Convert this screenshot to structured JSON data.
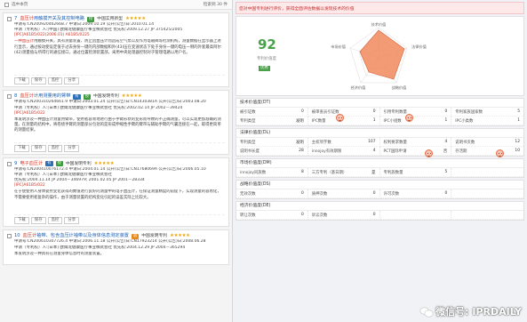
{
  "left": {
    "toolbar": {
      "select_label": "选中本页",
      "page_info": "检索到 30 件"
    },
    "results": [
      {
        "num": "7",
        "title_hl": "血压计",
        "title_rest": "用触摸开关及其控制电路",
        "type": "中国实用新型",
        "stars": "★★★★★",
        "meta1": "申请号:CN200920462668.7  申请日:2009.10.19  公开(公告)日:2010.01.14",
        "meta2": "申请（专利权）人:[中国] 欧姆龙健康医疗事业株式会社  优先权:2009.12.27 JP 375425/2005",
        "ipc": "[IPC]A61B5/022(2006.01) A61B5/0225",
        "abstract_hl": "一种血压计",
        "abstract_rest": "用触摸开关，具有测量装置、防止因血压计而造成空气泵以及作为电磁阀等检测机构，测量数据在显示器上进行显示，通过按动使设定值于过去身份一键的内部数据和外(43)压在变速状态下处于身份一键的电压一侧的外套最高阿尔(42)测量值与所得行的通信接口，通过位置检测装置部，采用中央处理器控制对于管理电路以用户名。",
        "actions": [
          "下载",
          "保存",
          "监控",
          "分享"
        ]
      },
      {
        "num": "8",
        "title_hl": "血压计",
        "title_rest": "计用测量用的臂带",
        "type": "中国发明专利",
        "stars": "★★★★★",
        "meta1": "申请号:CN200310264661.9  申请日:2003.01.24  公开(公告)日:CN1430381A  公开(公告)日:2003.08.20",
        "meta2": "申请（专利权）人:[日本] 欧姆龙健康医疗事业株式会社  优先权:2002.02.14 JP 2002－39424",
        "ipc": "[IPC]A61B5/022",
        "abstract_hl": "",
        "abstract_rest": "本发明涉及一种血压计测量用臂带，使用者容易地进行由于手臂形状的变形而导致的不正确测量，可以实现更加准确的测量。在测量的结构中，将卷绕手臂的测量部分包括的是形成伸缩性手臂的臂带与辅助手臂的气囊连接在一起，取得更简单的测量结果。",
        "actions": [
          "下载",
          "保存",
          "监控",
          "分享"
        ]
      },
      {
        "num": "9",
        "title_hl": "电子血压计",
        "title_rest": "",
        "type": "中国发明专利",
        "stars": "★★★★★",
        "meta1": "申请号:CN200410076172.4  申请日:2004.01.14  公开(公告)日:CN1768069A  公开(公告)日:2006.05.10",
        "meta2": "申请（专利权）人:[日本] 欧姆龙健康医疗事业株式会社",
        "meta3": "优先权:2004.11.14 JP 2004－346979; 2001.02.05 JP 2001－28334",
        "ipc": "[IPC]A61B5/022",
        "abstract_hl": "",
        "abstract_rest": "在于使使用人身体姿势变化获得的数值进行良好的测量中的电子血压计，在保证测量精度的前提下，实现测量的容易化，不需要使用者复杂的操作，由于测量装置的结构变化引起的误差实际上比较大。",
        "actions": [
          "下载",
          "保存",
          "监控",
          "分享"
        ]
      },
      {
        "num": "10",
        "title_hl": "血压计",
        "title_rest": "袖带、包含血压计袖带以及身体信息测定装置",
        "type": "中国发明专利",
        "stars": "★★★★★",
        "meta1": "申请号:CN200610307726.4  申请日:2006.11.18  公开(公告)日:CN17923214  公开(公告)日:2008.06.28",
        "meta2": "申请（专利权）人:[日本] 欧姆龙健康医疗事业株式会社  优先权:2004.12.29 JP 2004－365294",
        "ipc": "",
        "abstract_hl": "",
        "abstract_rest": "本发明涉及一种具有在测量身体信息时的测量装置。",
        "actions": [
          "下载",
          "保存",
          "监控",
          "分享"
        ]
      }
    ]
  },
  "right": {
    "banner": "您对中国专利进行评价，获得全面评估数据以发现技术的价值",
    "score": {
      "value": "92",
      "label": "专利价值度",
      "tag": "优秀"
    },
    "radar": {
      "axes": [
        "技术价值",
        "法律价值",
        "战略价值",
        "经济价值",
        "市场价值"
      ],
      "colors": {
        "fill": "#f08a5d",
        "stroke": "#d9603a"
      }
    },
    "sections": [
      {
        "title": "技术价值度(DT)",
        "value": "80",
        "cells": [
          [
            "被引证数",
            "0",
            false
          ],
          [
            "被审查员引证数",
            "0",
            false
          ],
          [
            "引用专利数量",
            "0",
            false
          ],
          [
            "专利家族国家数",
            "5",
            false
          ],
          [
            "专利类型",
            "发明",
            false
          ],
          [
            "IPC数量",
            "1",
            false
          ],
          [
            "IPC小组数",
            "1",
            false
          ],
          [
            "IPC小类数",
            "1",
            false
          ]
        ]
      },
      {
        "title": "法律价值度(DL)",
        "value": "85",
        "cells": [
          [
            "专利类型",
            "发明",
            false
          ],
          [
            "主权项字数",
            "107",
            false
          ],
          [
            "权利要求数量",
            "4",
            false
          ],
          [
            "说明书页数",
            "12",
            false
          ],
          [
            "说明书长度",
            "28",
            false
          ],
          [
            "innojoy有效期限",
            "4",
            false
          ],
          [
            "PCT国际申请",
            "否",
            false
          ],
          [
            "存活期",
            "10",
            false
          ]
        ]
      },
      {
        "title": "市场价值度(DM)",
        "value": "60",
        "cells": [
          [
            "innojoy同族数",
            "8",
            false
          ],
          [
            "三方专利（基日期）",
            "是",
            false
          ],
          [
            "专利族数量",
            "5",
            false
          ],
          [
            "",
            "",
            false
          ]
        ]
      },
      {
        "title": "战略价值度(DS)",
        "value": "",
        "cells": [
          [
            "无效次数",
            "0",
            false
          ],
          [
            "质押次数",
            "0",
            false
          ],
          [
            "许可次数",
            "0",
            false
          ],
          [
            "",
            "",
            false
          ]
        ]
      },
      {
        "title": "经济价值度(DE)",
        "value": "",
        "cells": [
          [
            "转让次数",
            "0",
            false
          ],
          [
            "诉讼次数",
            "0",
            false
          ],
          [
            "",
            "",
            false
          ],
          [
            "",
            "",
            false
          ]
        ]
      }
    ]
  },
  "watermark": {
    "text": "微信号: IPRDAILY",
    "icon": "wechat-icon"
  }
}
